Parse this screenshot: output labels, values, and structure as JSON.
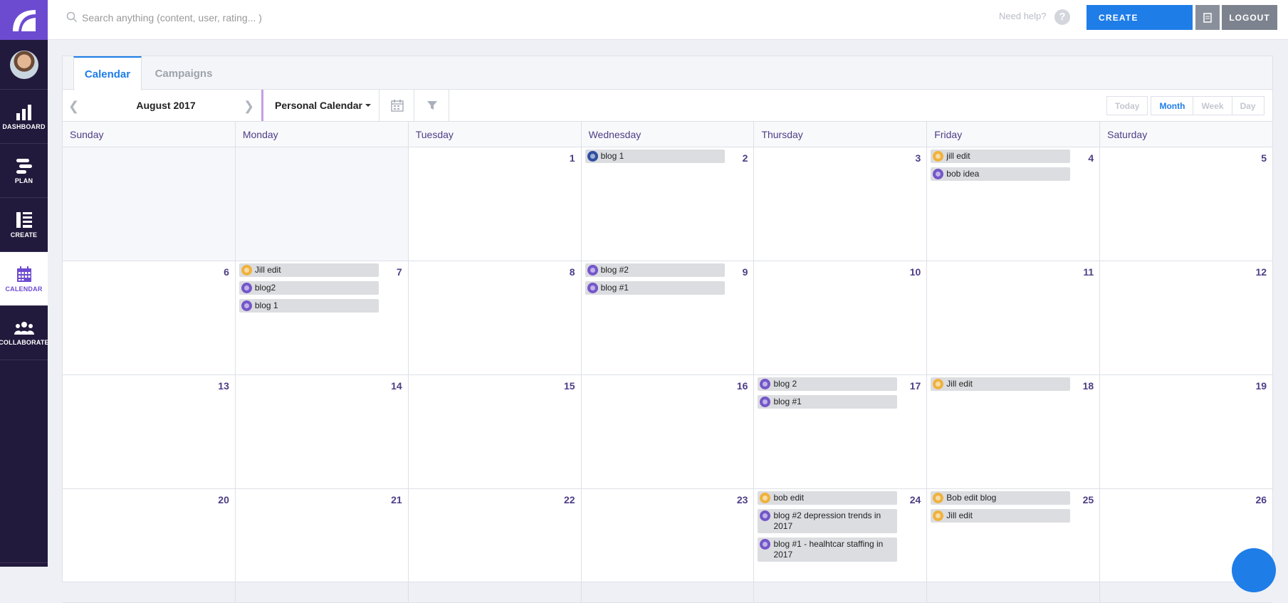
{
  "sidebar": {
    "items": [
      {
        "label": "DASHBOARD",
        "icon": "bar-chart-icon"
      },
      {
        "label": "PLAN",
        "icon": "plan-icon"
      },
      {
        "label": "CREATE",
        "icon": "create-icon"
      },
      {
        "label": "CALENDAR",
        "icon": "calendar-icon",
        "active": true
      },
      {
        "label": "COLLABORATE",
        "icon": "people-icon"
      }
    ]
  },
  "topbar": {
    "search_placeholder": "Search anything (content, user, rating... )",
    "help_text": "Need help?",
    "help_glyph": "?",
    "create_label": "CREATE",
    "logout_label": "LOGOUT"
  },
  "tabs": {
    "calendar": "Calendar",
    "campaigns": "Campaigns"
  },
  "toolbar": {
    "month": "August 2017",
    "calendar_select": "Personal Calendar",
    "views": {
      "today": "Today",
      "month": "Month",
      "week": "Week",
      "day": "Day"
    },
    "active_view": "Month"
  },
  "days": [
    "Sunday",
    "Monday",
    "Tuesday",
    "Wednesday",
    "Thursday",
    "Friday",
    "Saturday"
  ],
  "colors": {
    "accent": "#1f7de8",
    "brand": "#6d4bd1",
    "sidebar": "#221a3c",
    "idea": "#7457c9",
    "edit": "#efb23d",
    "blog": "#2e4f9f"
  },
  "weeks": [
    [
      {
        "day": "",
        "events": []
      },
      {
        "day": "",
        "events": []
      },
      {
        "day": "1",
        "events": []
      },
      {
        "day": "2",
        "events": [
          {
            "title": "blog 1",
            "type": "blog"
          }
        ]
      },
      {
        "day": "3",
        "events": []
      },
      {
        "day": "4",
        "events": [
          {
            "title": "jill edit",
            "type": "edit"
          },
          {
            "title": "bob idea",
            "type": "idea"
          }
        ]
      },
      {
        "day": "5",
        "events": []
      }
    ],
    [
      {
        "day": "6",
        "events": []
      },
      {
        "day": "7",
        "events": [
          {
            "title": "Jill edit",
            "type": "edit"
          },
          {
            "title": "blog2",
            "type": "idea"
          },
          {
            "title": "blog 1",
            "type": "idea"
          }
        ]
      },
      {
        "day": "8",
        "events": []
      },
      {
        "day": "9",
        "events": [
          {
            "title": "blog #2",
            "type": "idea"
          },
          {
            "title": "blog #1",
            "type": "idea"
          }
        ]
      },
      {
        "day": "10",
        "events": []
      },
      {
        "day": "11",
        "events": []
      },
      {
        "day": "12",
        "events": []
      }
    ],
    [
      {
        "day": "13",
        "events": []
      },
      {
        "day": "14",
        "events": []
      },
      {
        "day": "15",
        "events": []
      },
      {
        "day": "16",
        "events": []
      },
      {
        "day": "17",
        "events": [
          {
            "title": "blog 2",
            "type": "idea"
          },
          {
            "title": "blog #1",
            "type": "idea"
          }
        ]
      },
      {
        "day": "18",
        "events": [
          {
            "title": "Jill edit",
            "type": "edit"
          }
        ]
      },
      {
        "day": "19",
        "events": []
      }
    ],
    [
      {
        "day": "20",
        "events": []
      },
      {
        "day": "21",
        "events": []
      },
      {
        "day": "22",
        "events": []
      },
      {
        "day": "23",
        "events": []
      },
      {
        "day": "24",
        "events": [
          {
            "title": "bob edit",
            "type": "edit"
          },
          {
            "title": "blog #2 depression trends in 2017",
            "type": "idea"
          },
          {
            "title": "blog #1 - healhtcar staffing in 2017",
            "type": "idea"
          }
        ]
      },
      {
        "day": "25",
        "events": [
          {
            "title": "Bob edit blog",
            "type": "edit"
          },
          {
            "title": "Jill edit",
            "type": "edit"
          }
        ]
      },
      {
        "day": "26",
        "events": []
      }
    ]
  ]
}
